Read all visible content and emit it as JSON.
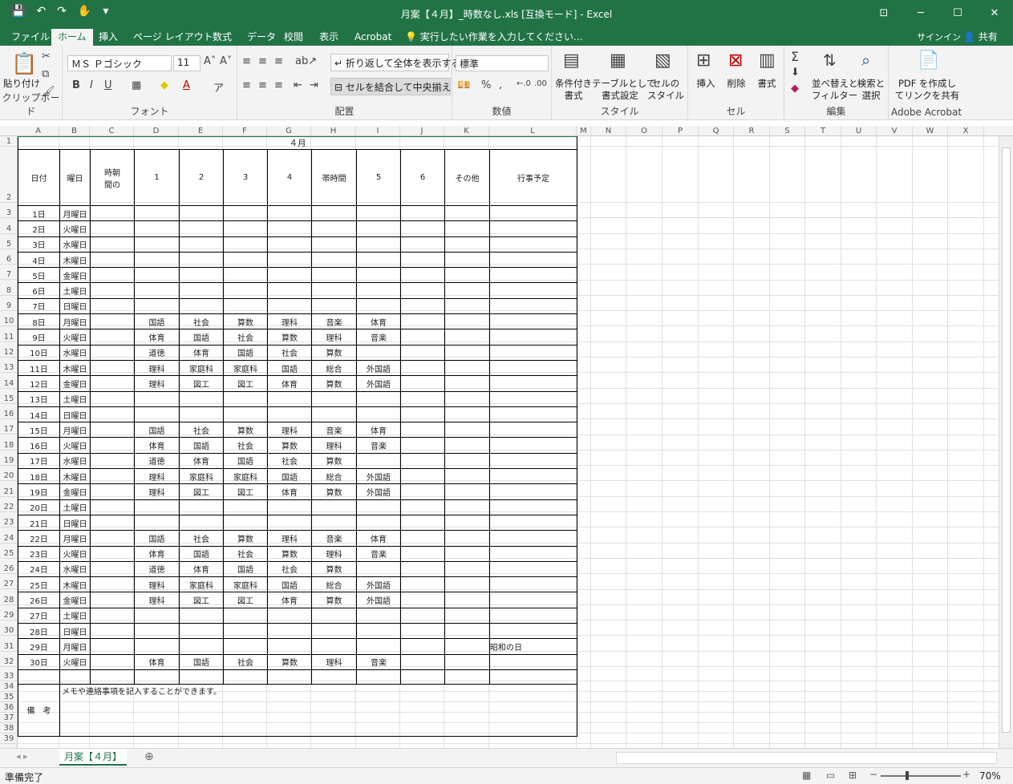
{
  "window": {
    "title": "月案【４月】_時数なし.xls [互換モード] - Excel",
    "controls": [
      "⊡",
      "─",
      "☐",
      "✕"
    ]
  },
  "qat": [
    "💾",
    "↶",
    "↷",
    "✋",
    "▾"
  ],
  "tabs": [
    "ファイル",
    "ホーム",
    "挿入",
    "ページ レイアウト",
    "数式",
    "データ",
    "校閲",
    "表示",
    "Acrobat"
  ],
  "tellme": "実行したい作業を入力してください...",
  "signin": "サインイン",
  "share": "共有",
  "ribbon": {
    "clipboard": {
      "paste": "貼り付け",
      "group": "クリップボード"
    },
    "font": {
      "name": "ＭＳ Ｐゴシック",
      "size": "11",
      "group": "フォント"
    },
    "align": {
      "wrap": "折り返して全体を表示する",
      "merge": "セルを結合して中央揃え",
      "group": "配置"
    },
    "number": {
      "format": "標準",
      "group": "数値"
    },
    "styles": {
      "cond": "条件付き\n書式",
      "table": "テーブルとして\n書式設定",
      "cell": "セルの\nスタイル",
      "group": "スタイル"
    },
    "cells": {
      "insert": "挿入",
      "delete": "削除",
      "format": "書式",
      "group": "セル"
    },
    "edit": {
      "sort": "並べ替えと\nフィルター",
      "find": "検索と\n選択",
      "group": "編集"
    },
    "acrobat": {
      "pdf": "PDF を作成し\nてリンクを共有",
      "group": "Adobe Acrobat"
    }
  },
  "columns": [
    "A",
    "B",
    "C",
    "D",
    "E",
    "F",
    "G",
    "H",
    "I",
    "J",
    "K",
    "L",
    "M",
    "N",
    "O",
    "P",
    "Q",
    "R",
    "S",
    "T",
    "U",
    "V",
    "W",
    "X"
  ],
  "sheet": {
    "month": "４月",
    "header": [
      "日付",
      "曜日",
      "時朝\n間の",
      "1",
      "2",
      "3",
      "4",
      "帯時間",
      "5",
      "6",
      "その他",
      "行事予定"
    ],
    "rows": [
      [
        "1日",
        "月曜日",
        "",
        "",
        "",
        "",
        "",
        "",
        "",
        "",
        "",
        ""
      ],
      [
        "2日",
        "火曜日",
        "",
        "",
        "",
        "",
        "",
        "",
        "",
        "",
        "",
        ""
      ],
      [
        "3日",
        "水曜日",
        "",
        "",
        "",
        "",
        "",
        "",
        "",
        "",
        "",
        ""
      ],
      [
        "4日",
        "木曜日",
        "",
        "",
        "",
        "",
        "",
        "",
        "",
        "",
        "",
        ""
      ],
      [
        "5日",
        "金曜日",
        "",
        "",
        "",
        "",
        "",
        "",
        "",
        "",
        "",
        ""
      ],
      [
        "6日",
        "土曜日",
        "",
        "",
        "",
        "",
        "",
        "",
        "",
        "",
        "",
        ""
      ],
      [
        "7日",
        "日曜日",
        "",
        "",
        "",
        "",
        "",
        "",
        "",
        "",
        "",
        ""
      ],
      [
        "8日",
        "月曜日",
        "",
        "国語",
        "社会",
        "算数",
        "理科",
        "音楽",
        "体育",
        "",
        "",
        ""
      ],
      [
        "9日",
        "火曜日",
        "",
        "体育",
        "国語",
        "社会",
        "算数",
        "理科",
        "音楽",
        "",
        "",
        ""
      ],
      [
        "10日",
        "水曜日",
        "",
        "道徳",
        "体育",
        "国語",
        "社会",
        "算数",
        "",
        "",
        "",
        ""
      ],
      [
        "11日",
        "木曜日",
        "",
        "理科",
        "家庭科",
        "家庭科",
        "国語",
        "総合",
        "外国語",
        "",
        "",
        ""
      ],
      [
        "12日",
        "金曜日",
        "",
        "理科",
        "図工",
        "図工",
        "体育",
        "算数",
        "外国語",
        "",
        "",
        ""
      ],
      [
        "13日",
        "土曜日",
        "",
        "",
        "",
        "",
        "",
        "",
        "",
        "",
        "",
        ""
      ],
      [
        "14日",
        "日曜日",
        "",
        "",
        "",
        "",
        "",
        "",
        "",
        "",
        "",
        ""
      ],
      [
        "15日",
        "月曜日",
        "",
        "国語",
        "社会",
        "算数",
        "理科",
        "音楽",
        "体育",
        "",
        "",
        ""
      ],
      [
        "16日",
        "火曜日",
        "",
        "体育",
        "国語",
        "社会",
        "算数",
        "理科",
        "音楽",
        "",
        "",
        ""
      ],
      [
        "17日",
        "水曜日",
        "",
        "道徳",
        "体育",
        "国語",
        "社会",
        "算数",
        "",
        "",
        "",
        ""
      ],
      [
        "18日",
        "木曜日",
        "",
        "理科",
        "家庭科",
        "家庭科",
        "国語",
        "総合",
        "外国語",
        "",
        "",
        ""
      ],
      [
        "19日",
        "金曜日",
        "",
        "理科",
        "図工",
        "図工",
        "体育",
        "算数",
        "外国語",
        "",
        "",
        ""
      ],
      [
        "20日",
        "土曜日",
        "",
        "",
        "",
        "",
        "",
        "",
        "",
        "",
        "",
        ""
      ],
      [
        "21日",
        "日曜日",
        "",
        "",
        "",
        "",
        "",
        "",
        "",
        "",
        "",
        ""
      ],
      [
        "22日",
        "月曜日",
        "",
        "国語",
        "社会",
        "算数",
        "理科",
        "音楽",
        "体育",
        "",
        "",
        ""
      ],
      [
        "23日",
        "火曜日",
        "",
        "体育",
        "国語",
        "社会",
        "算数",
        "理科",
        "音楽",
        "",
        "",
        ""
      ],
      [
        "24日",
        "水曜日",
        "",
        "道徳",
        "体育",
        "国語",
        "社会",
        "算数",
        "",
        "",
        "",
        ""
      ],
      [
        "25日",
        "木曜日",
        "",
        "理科",
        "家庭科",
        "家庭科",
        "国語",
        "総合",
        "外国語",
        "",
        "",
        ""
      ],
      [
        "26日",
        "金曜日",
        "",
        "理科",
        "図工",
        "図工",
        "体育",
        "算数",
        "外国語",
        "",
        "",
        ""
      ],
      [
        "27日",
        "土曜日",
        "",
        "",
        "",
        "",
        "",
        "",
        "",
        "",
        "",
        ""
      ],
      [
        "28日",
        "日曜日",
        "",
        "",
        "",
        "",
        "",
        "",
        "",
        "",
        "",
        ""
      ],
      [
        "29日",
        "月曜日",
        "",
        "",
        "",
        "",
        "",
        "",
        "",
        "",
        "",
        "昭和の日"
      ],
      [
        "30日",
        "火曜日",
        "",
        "体育",
        "国語",
        "社会",
        "算数",
        "理科",
        "音楽",
        "",
        "",
        ""
      ]
    ],
    "remarks_label": "備　考",
    "remarks_text": "メモや連絡事項を記入することができます。"
  },
  "sheet_tab": "月案【４月】",
  "status": "準備完了",
  "zoom": "70%"
}
